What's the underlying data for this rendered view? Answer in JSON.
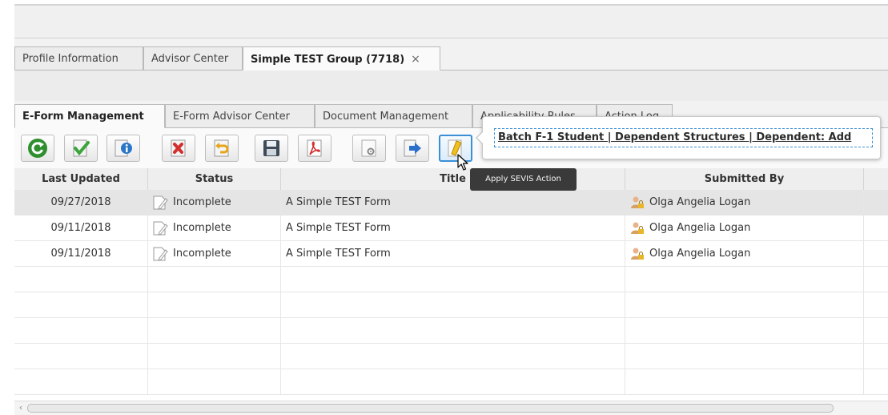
{
  "window_tabs": [
    {
      "label": "Profile Information",
      "active": false
    },
    {
      "label": "Advisor Center",
      "active": false
    },
    {
      "label": "Simple TEST Group (7718)",
      "active": true,
      "close": "×"
    }
  ],
  "section_tabs": [
    {
      "label": "E-Form Management",
      "active": true
    },
    {
      "label": "E-Form Advisor Center",
      "active": false
    },
    {
      "label": "Document Management",
      "active": false
    },
    {
      "label": "Applicability Rules",
      "active": false
    },
    {
      "label": "Action Log",
      "active": false
    }
  ],
  "toolbar": {
    "buttons": [
      "refresh-icon",
      "approve-icon",
      "info-icon",
      "delete-icon",
      "return-icon",
      "save-icon",
      "pdf-icon",
      "settings-doc-icon",
      "export-icon",
      "sevis-action-icon"
    ],
    "active_button": "sevis-action-icon"
  },
  "popover": {
    "action": "Batch F-1 Student | Dependent Structures | Dependent: Add"
  },
  "tooltip": {
    "text": "Apply SEVIS Action"
  },
  "grid": {
    "columns": [
      "Last Updated",
      "Status",
      "Title",
      "Submitted By"
    ],
    "rows": [
      {
        "last_updated": "09/27/2018",
        "status": "Incomplete",
        "title": "A Simple TEST Form",
        "submitted_by": "Olga Angelia Logan"
      },
      {
        "last_updated": "09/11/2018",
        "status": "Incomplete",
        "title": "A Simple TEST Form",
        "submitted_by": "Olga Angelia Logan"
      },
      {
        "last_updated": "09/11/2018",
        "status": "Incomplete",
        "title": "A Simple TEST Form",
        "submitted_by": "Olga Angelia Logan"
      }
    ]
  },
  "scrollbar": {
    "left_arrow": "‹"
  },
  "colors": {
    "accent": "#3a8fd6",
    "selected_row": "#e5e5e5",
    "tooltip_bg": "#3a3a3a"
  }
}
